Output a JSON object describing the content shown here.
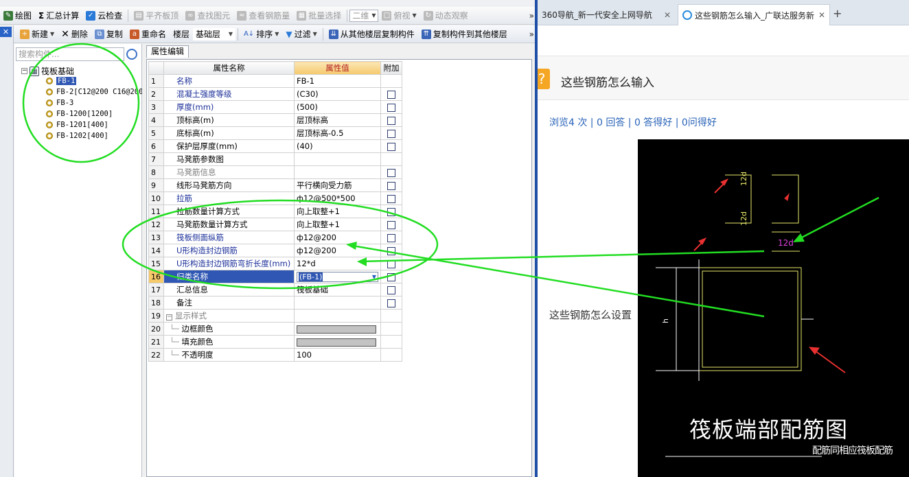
{
  "toolbar1": {
    "items": [
      "绘图",
      "汇总计算",
      "云检查",
      "平齐板顶",
      "查找图元",
      "查看钢筋量",
      "批量选择"
    ],
    "view_select": "二维",
    "view_btn": "俯视",
    "anim_btn": "动态观察",
    "more": "»"
  },
  "toolbar2": {
    "new": "新建",
    "delete": "删除",
    "copy": "复制",
    "rename": "重命名",
    "floor_label": "楼层",
    "floor_value": "基础层",
    "sort": "排序",
    "filter": "过滤",
    "copy_from": "从其他楼层复制构件",
    "copy_to": "复制构件到其他楼层",
    "more": "»"
  },
  "left_strip": {
    "close": "✕"
  },
  "tree": {
    "search_placeholder": "搜索构件...",
    "root": "筏板基础",
    "items": [
      "FB-1",
      "FB-2[C12@200 C16@200",
      "FB-3",
      "FB-1200[1200]",
      "FB-1201[400]",
      "FB-1202[400]"
    ]
  },
  "props": {
    "tab": "属性编辑",
    "headers": {
      "name": "属性名称",
      "value": "属性值",
      "extra": "附加"
    },
    "rows": [
      {
        "n": "1",
        "name": "名称",
        "value": "FB-1"
      },
      {
        "n": "2",
        "name": "混凝土强度等级",
        "value": "(C30)"
      },
      {
        "n": "3",
        "name": "厚度(mm)",
        "value": "(500)"
      },
      {
        "n": "4",
        "name": "顶标高(m)",
        "value": "层顶标高"
      },
      {
        "n": "5",
        "name": "底标高(m)",
        "value": "层顶标高-0.5"
      },
      {
        "n": "6",
        "name": "保护层厚度(mm)",
        "value": "(40)"
      },
      {
        "n": "7",
        "name": "马凳筋参数图",
        "value": ""
      },
      {
        "n": "8",
        "name": "马凳筋信息",
        "value": ""
      },
      {
        "n": "9",
        "name": "线形马凳筋方向",
        "value": "平行横向受力筋"
      },
      {
        "n": "10",
        "name": "拉筋",
        "value": "ф12@500*500"
      },
      {
        "n": "11",
        "name": "拉筋数量计算方式",
        "value": "向上取整+1"
      },
      {
        "n": "12",
        "name": "马凳筋数量计算方式",
        "value": "向上取整+1"
      },
      {
        "n": "13",
        "name": "筏板侧面纵筋",
        "value": "ф12@200"
      },
      {
        "n": "14",
        "name": "U形构造封边钢筋",
        "value": "ф12@200"
      },
      {
        "n": "15",
        "name": "U形构造封边钢筋弯折长度(mm)",
        "value": "12*d"
      },
      {
        "n": "16",
        "name": "归类名称",
        "value": "(FB-1)"
      },
      {
        "n": "17",
        "name": "汇总信息",
        "value": "筏板基础"
      },
      {
        "n": "18",
        "name": "备注",
        "value": ""
      },
      {
        "n": "19",
        "name": "显示样式",
        "value": ""
      },
      {
        "n": "20",
        "name": "边框颜色",
        "value": ""
      },
      {
        "n": "21",
        "name": "填充颜色",
        "value": ""
      },
      {
        "n": "22",
        "name": "不透明度",
        "value": "100"
      }
    ]
  },
  "browser": {
    "tab1": "360导航_新一代安全上网导航",
    "tab2": "这些钢筋怎么输入_广联达服务新",
    "question_title": "这些钢筋怎么输入",
    "stats": "浏览4 次 | 0 回答 | 0 答得好 | 0问得好",
    "body_text": "这些钢筋怎么设置",
    "cad_labels": {
      "d1": "12d",
      "d2": "12d",
      "d3": "12d",
      "h": "h",
      "note": "配筋同相应筏板配筋",
      "title": "筏板端部配筋图"
    }
  },
  "colors": {
    "annotation": "#22dd22",
    "selection": "#2f57b3",
    "link": "#2963b8",
    "cad_bg": "#000000",
    "cad_yellow": "#e8e86a",
    "cad_magenta": "#e040e0",
    "cad_red": "#e83030"
  }
}
